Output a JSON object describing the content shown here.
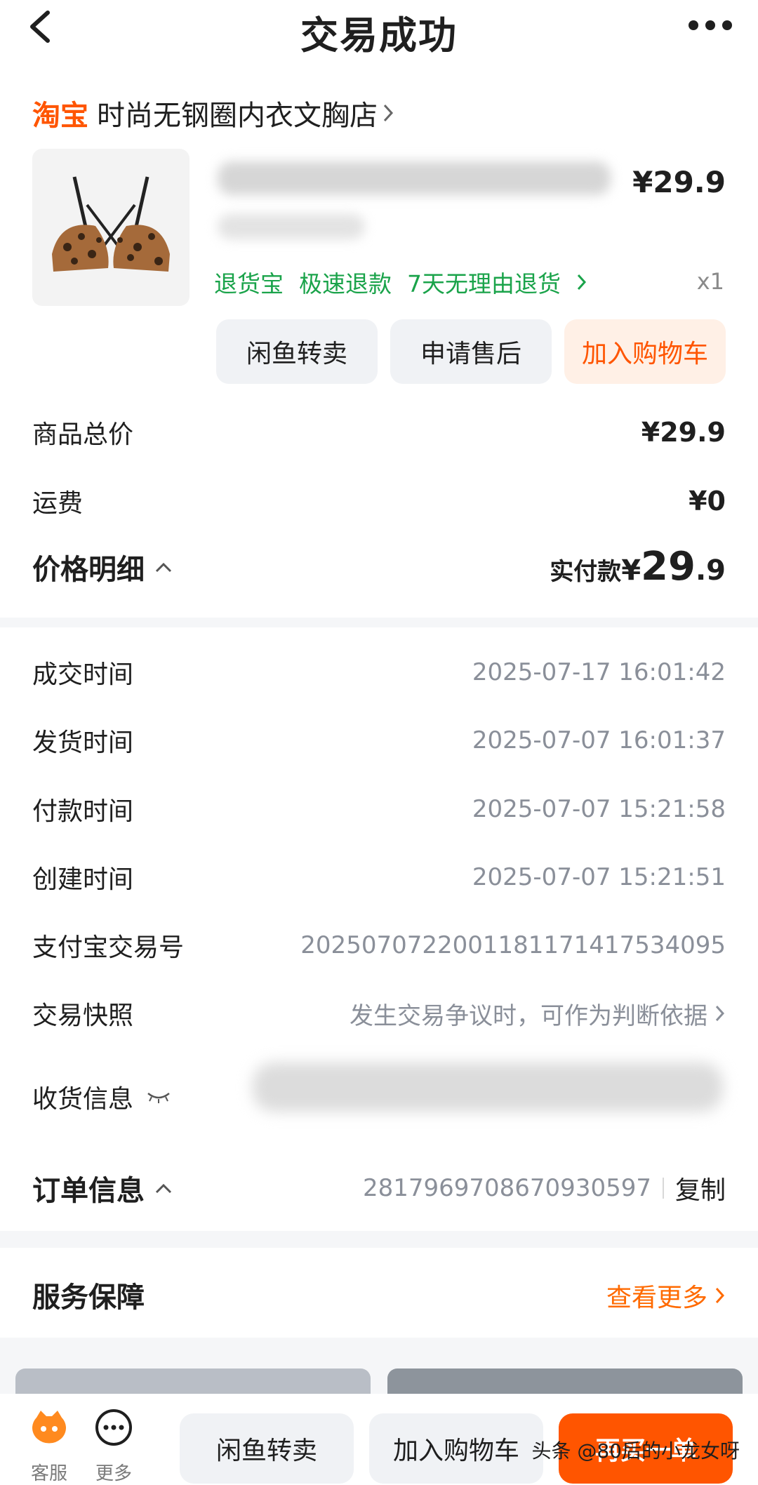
{
  "header": {
    "title": "交易成功"
  },
  "shop": {
    "brand": "淘宝",
    "name": "时尚无钢圈内衣文胸店"
  },
  "product": {
    "price": "¥29.9",
    "tags": [
      "退货宝",
      "极速退款",
      "7天无理由退货"
    ],
    "qty": "x1",
    "actions": [
      "闲鱼转卖",
      "申请售后",
      "加入购物车"
    ]
  },
  "summary": {
    "total_label": "商品总价",
    "total_value": "¥29.9",
    "shipping_label": "运费",
    "shipping_value": "¥0",
    "detail_label": "价格明细",
    "paid_prefix": "实付款",
    "paid_currency": "¥",
    "paid_int": "29",
    "paid_dec": ".9"
  },
  "info": {
    "rows": [
      {
        "label": "成交时间",
        "value": "2025-07-17 16:01:42"
      },
      {
        "label": "发货时间",
        "value": "2025-07-07 16:01:37"
      },
      {
        "label": "付款时间",
        "value": "2025-07-07 15:21:58"
      },
      {
        "label": "创建时间",
        "value": "2025-07-07 15:21:51"
      },
      {
        "label": "支付宝交易号",
        "value": "2025070722001181171417534095"
      },
      {
        "label": "交易快照",
        "value": "发生交易争议时，可作为判断依据"
      },
      {
        "label": "收货信息",
        "value": ""
      }
    ],
    "order_label": "订单信息",
    "order_number": "2817969708670930597",
    "copy_label": "复制"
  },
  "service": {
    "title": "服务保障",
    "more": "查看更多"
  },
  "bottom": {
    "icons": [
      {
        "label": "客服"
      },
      {
        "label": "更多"
      }
    ],
    "buttons": [
      "闲鱼转卖",
      "加入购物车",
      "再买一单"
    ],
    "watermark": "头条 @80后的小龙女呀"
  },
  "colors": {
    "accent": "#ff5500",
    "green": "#1aa34a",
    "muted": "#8a8f99"
  }
}
